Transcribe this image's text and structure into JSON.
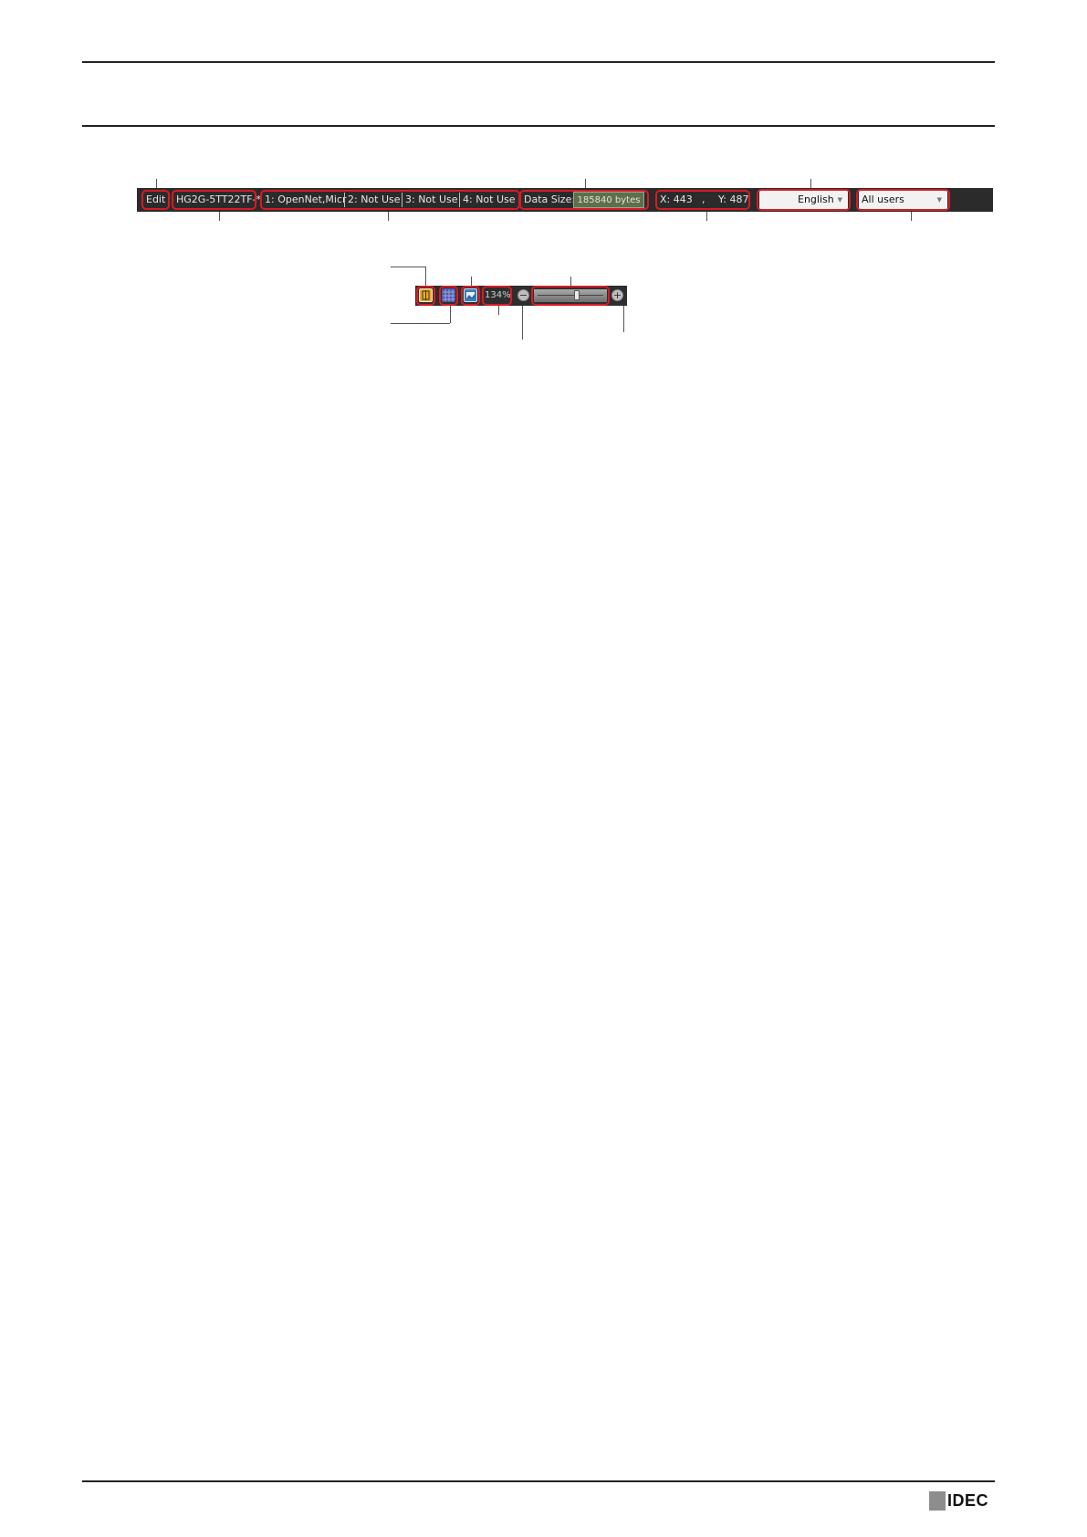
{
  "status_bar": {
    "mode": "Edit",
    "model": "HG2G-5TT22TF-*",
    "ports": [
      "1: OpenNet,Micr",
      "2: Not Use",
      "3: Not Use",
      "4: Not Use"
    ],
    "data_size_label": "Data Size:",
    "data_size_value": "185840 bytes",
    "coord_x": "X: 443",
    "coord_sep": ",",
    "coord_y": "Y: 487",
    "language": "English",
    "user": "All users"
  },
  "zoom_toolbar": {
    "zoom_percent": "134%",
    "slider_level_fraction": 0.6,
    "icons": [
      "fit-screen-icon",
      "grid-icon",
      "picture-icon"
    ]
  },
  "footer": {
    "logo_text": "IDEC"
  }
}
